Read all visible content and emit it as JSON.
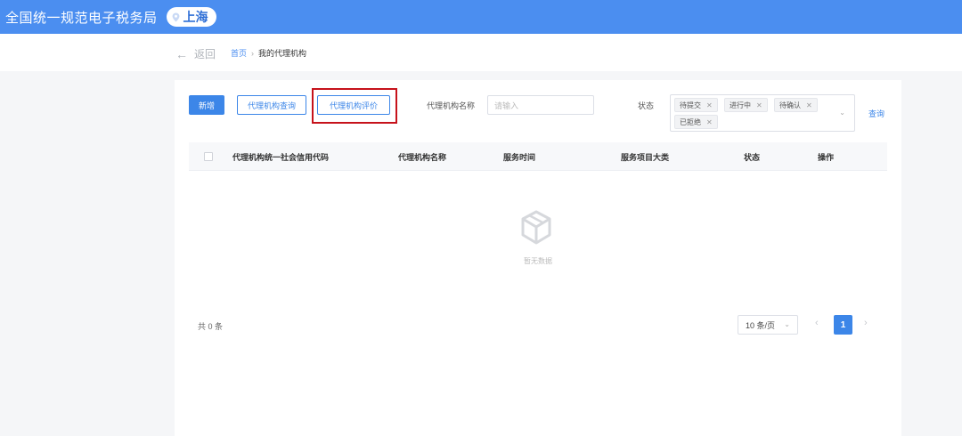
{
  "header": {
    "site_title": "全国统一规范电子税务局",
    "city": "上海"
  },
  "breadcrumb": {
    "back_label": "返回",
    "home": "首页",
    "current": "我的代理机构"
  },
  "toolbar": {
    "new_label": "新增",
    "agency_query_label": "代理机构查询",
    "agency_review_label": "代理机构评价"
  },
  "filters": {
    "agency_name_label": "代理机构名称",
    "agency_name_placeholder": "请输入",
    "status_label": "状态",
    "status_tags": [
      "待提交",
      "进行中",
      "待确认",
      "已拒绝"
    ],
    "query_label": "查询"
  },
  "table": {
    "columns": [
      "代理机构统一社会信用代码",
      "代理机构名称",
      "服务时间",
      "服务项目大类",
      "状态",
      "操作"
    ],
    "rows": [],
    "empty_text": "暂无数据"
  },
  "pagination": {
    "total_text": "共 0 条",
    "page_size": "10 条/页",
    "current_page": "1"
  },
  "colors": {
    "header_bg": "#4b8ef0",
    "primary": "#3c86e8",
    "highlight_border": "#c6121b"
  }
}
